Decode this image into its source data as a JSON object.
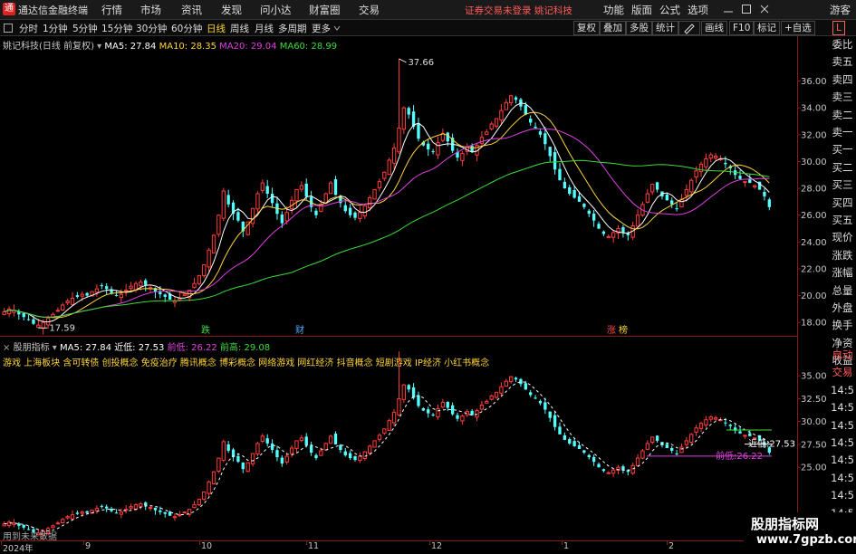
{
  "app": {
    "title": "通达信金融终端",
    "logo_char": "通",
    "menus": [
      "行情",
      "市场",
      "资讯",
      "发现",
      "问小达",
      "财富圈",
      "交易"
    ],
    "warning": "证券交易未登录  姚记科技",
    "right_menus": [
      "功能",
      "版面",
      "公式",
      "选项"
    ],
    "guest": "游客",
    "window_icons": [
      "minimize-icon",
      "maximize-icon",
      "close-icon"
    ]
  },
  "toolbar": {
    "periods": [
      "分时",
      "1分钟",
      "5分钟",
      "15分钟",
      "30分钟",
      "60分钟",
      "日线",
      "周线",
      "月线",
      "多周期",
      "更多"
    ],
    "active_period": "日线",
    "right_buttons": [
      "复权",
      "叠加",
      "多股",
      "统计",
      "画线",
      "F10",
      "标记",
      "+自选"
    ],
    "indicator_toggle": "L"
  },
  "main_chart": {
    "legend_name": "姚记科技(日线 前复权)",
    "ma": [
      {
        "label": "MA5: 27.84",
        "color": "#ffffff"
      },
      {
        "label": "MA10: 28.35",
        "color": "#ffd43b"
      },
      {
        "label": "MA20: 29.04",
        "color": "#e040e0"
      },
      {
        "label": "MA60: 28.99",
        "color": "#3cdc3c"
      }
    ],
    "high_label": "37.66",
    "low_label": "17.59",
    "event_labels": [
      {
        "text": "跌",
        "color": "#3cdc3c"
      },
      {
        "text": "财",
        "color": "#55aaff"
      },
      {
        "text": "涨",
        "color": "#ff4444"
      },
      {
        "text": "榜",
        "color": "#ffd43b"
      }
    ]
  },
  "sub_chart": {
    "legend_name": "股朋指标",
    "items": [
      {
        "label": "MA5: 27.84",
        "color": "#ffffff"
      },
      {
        "label": "近低: 27.53",
        "color": "#ffffff"
      },
      {
        "label": "前低: 26.22",
        "color": "#e040e0"
      },
      {
        "label": "前高: 29.08",
        "color": "#3cdc3c"
      }
    ],
    "concepts": "游戏 上海板块 含可转债 创投概念 免疫治疗 腾讯概念 博彩概念 网络游戏 网红经济 抖音概念 短剧游戏 IP经济 小红书概念",
    "label_near_low": "近低:27.53",
    "label_prev_low": "前低:26.22",
    "footer_note": "用到未来数据"
  },
  "sidebar": [
    "委比",
    "卖五",
    "卖四",
    "卖三",
    "卖二",
    "卖一",
    "买一",
    "买二",
    "买三",
    "买四",
    "买五",
    "现价",
    "涨跌",
    "涨幅",
    "总量",
    "外盘",
    "换手",
    "净资",
    "收益"
  ],
  "sidebar_lower": [
    "自动",
    "交易",
    "14:5",
    "14:5",
    "14:5",
    "14:5",
    "14:5",
    "14:5",
    "14:5",
    "14:5"
  ],
  "x_axis": [
    "2024年",
    "9",
    "10",
    "11",
    "12",
    "1",
    "2"
  ],
  "chart_data": [
    {
      "type": "candlestick",
      "title": "姚记科技(日线 前复权)",
      "y_ticks": [
        18.0,
        20.0,
        22.0,
        24.0,
        26.0,
        28.0,
        30.0,
        32.0,
        34.0,
        36.0
      ],
      "ylim": [
        17.0,
        38.4
      ],
      "x_labels": [
        "2024年",
        "9",
        "10",
        "11",
        "12",
        "1",
        "2"
      ],
      "closes": [
        18.8,
        19.0,
        18.9,
        18.6,
        18.4,
        18.2,
        17.9,
        17.8,
        18.0,
        18.3,
        18.6,
        18.9,
        19.3,
        19.6,
        19.8,
        19.9,
        20.1,
        20.0,
        20.3,
        20.5,
        20.7,
        20.5,
        20.2,
        20.0,
        20.1,
        20.4,
        20.7,
        20.9,
        21.0,
        20.8,
        20.6,
        20.3,
        20.1,
        19.9,
        19.7,
        19.6,
        19.8,
        20.1,
        20.4,
        20.9,
        21.5,
        22.3,
        23.4,
        24.5,
        26.0,
        27.8,
        26.8,
        26.1,
        25.6,
        24.8,
        25.5,
        26.5,
        27.6,
        28.4,
        27.6,
        26.9,
        26.1,
        25.4,
        26.2,
        27.1,
        27.9,
        28.2,
        27.4,
        26.6,
        26.0,
        26.8,
        27.6,
        28.4,
        27.5,
        26.9,
        26.3,
        26.0,
        25.8,
        26.2,
        26.7,
        27.3,
        27.9,
        28.5,
        29.2,
        30.1,
        31.0,
        32.5,
        34.0,
        33.5,
        32.6,
        31.7,
        31.2,
        30.9,
        30.7,
        31.4,
        32.1,
        31.5,
        30.8,
        30.3,
        30.6,
        31.1,
        30.7,
        31.2,
        31.8,
        32.2,
        32.8,
        33.2,
        33.8,
        34.4,
        34.9,
        34.6,
        34.1,
        33.5,
        32.9,
        32.5,
        32.0,
        31.3,
        30.4,
        29.4,
        28.6,
        28.0,
        27.6,
        27.3,
        27.0,
        26.6,
        26.1,
        25.6,
        25.0,
        24.6,
        24.4,
        24.7,
        25.0,
        24.7,
        24.5,
        25.2,
        26.0,
        26.8,
        27.6,
        28.3,
        27.9,
        27.4,
        27.1,
        26.8,
        26.5,
        27.2,
        27.9,
        28.6,
        29.3,
        29.8,
        30.2,
        30.5,
        30.4,
        30.2,
        29.8,
        29.5,
        29.0,
        28.7,
        28.5,
        28.4,
        28.2,
        27.9,
        27.4,
        26.6
      ]
    },
    {
      "type": "candlestick",
      "title": "股朋指标",
      "y_ticks": [
        25.0,
        27.5,
        30.0,
        32.5,
        35.0
      ],
      "ylim": [
        17.0,
        36.6
      ],
      "series": [
        {
          "name": "近低",
          "value": 27.53
        },
        {
          "name": "前低",
          "value": 26.22
        },
        {
          "name": "前高",
          "value": 29.08
        }
      ]
    }
  ]
}
